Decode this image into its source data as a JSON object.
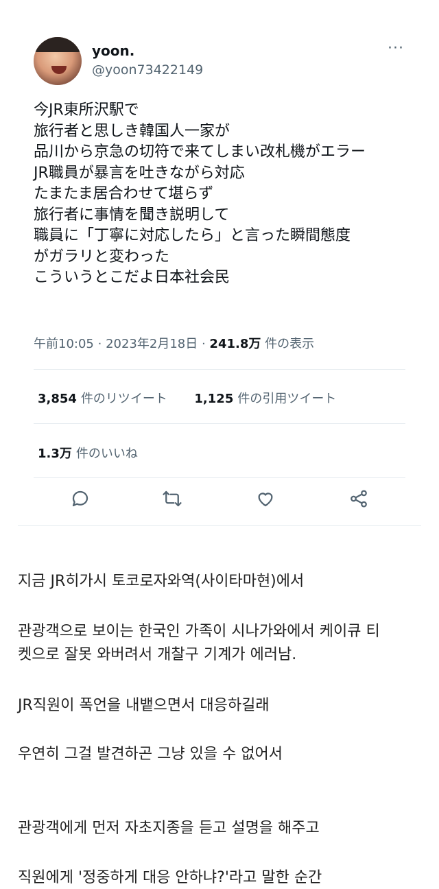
{
  "tweet": {
    "display_name": "yoon.",
    "handle": "@yoon73422149",
    "more_icon": "···",
    "text": "今JR東所沢駅で\n旅行者と思しき韓国人一家が\n品川から京急の切符で来てしまい改札機がエラー\nJR職員が暴言を吐きながら対応\nたまたま居合わせて堪らず\n旅行者に事情を聞き説明して\n職員に「丁寧に対応したら」と言った瞬間態度\nがガラリと変わった\nこういうとこだよ日本社会民",
    "time": "午前10:05",
    "date": "2023年2月18日",
    "views_count": "241.8万",
    "views_label": "件の表示",
    "retweets_count": "3,854",
    "retweets_label": "件のリツイート",
    "quotes_count": "1,125",
    "quotes_label": "件の引用ツイート",
    "likes_count": "1.3万",
    "likes_label": "件のいいね",
    "icons": [
      "reply-icon",
      "retweet-icon",
      "like-icon",
      "share-icon"
    ]
  },
  "translation": {
    "lines": [
      "지금 JR히가시 토코로자와역(사이타마현)에서",
      "관광객으로 보이는 한국인 가족이 시나가와에서 케이큐 티",
      "켓으로 잘못 와버려서 개찰구 기계가 에러남.",
      "JR직원이 폭언을 내뱉으면서 대응하길래",
      "우연히 그걸 발견하곤 그냥 있을 수 없어서",
      "관광객에게 먼저 자초지종을 듣고 설명을 해주고",
      "직원에게 '정중하게 대응 안하냐?'라고 말한 순간"
    ]
  }
}
